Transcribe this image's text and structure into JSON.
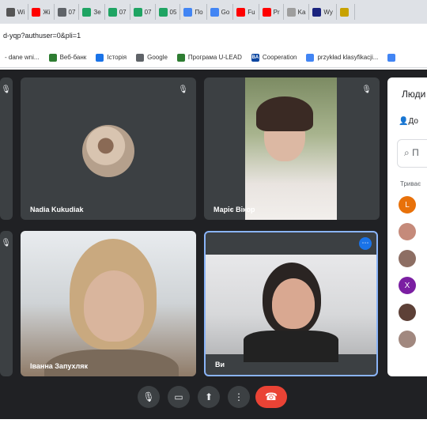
{
  "browser": {
    "tabs": [
      {
        "label": "Wi",
        "icon": "doc-icon",
        "color": "#555555"
      },
      {
        "label": "Жі",
        "icon": "youtube-icon",
        "color": "#ff0000"
      },
      {
        "label": "07",
        "icon": "globe-icon",
        "color": "#5f6368"
      },
      {
        "label": "Зе",
        "icon": "drive-icon",
        "color": "#1fa463"
      },
      {
        "label": "07",
        "icon": "drive-icon",
        "color": "#1fa463"
      },
      {
        "label": "07",
        "icon": "drive-icon",
        "color": "#1fa463"
      },
      {
        "label": "05",
        "icon": "drive-icon",
        "color": "#1fa463"
      },
      {
        "label": "По",
        "icon": "docs-icon",
        "color": "#4285f4"
      },
      {
        "label": "Go",
        "icon": "google-icon",
        "color": "#4285f4"
      },
      {
        "label": "Fu",
        "icon": "youtube-icon",
        "color": "#ff0000"
      },
      {
        "label": "Pr",
        "icon": "youtube-icon",
        "color": "#ff0000"
      },
      {
        "label": "Ka",
        "icon": "page-icon",
        "color": "#9e9e9e"
      },
      {
        "label": "Wy",
        "icon": "site-icon",
        "color": "#1a237e"
      },
      {
        "label": "",
        "icon": "crest-icon",
        "color": "#c8a200"
      }
    ],
    "url": "d-yqp?authuser=0&pli=1",
    "bookmarks": [
      {
        "label": "- dane wni...",
        "icon": "none"
      },
      {
        "label": "Веб-банк",
        "icon": "bank-icon",
        "color": "#2e7d32"
      },
      {
        "label": "Історія",
        "icon": "history-icon",
        "color": "#1a73e8"
      },
      {
        "label": "Google",
        "icon": "globe-icon",
        "color": "#5f6368"
      },
      {
        "label": "Програма U-LEAD",
        "icon": "person-icon",
        "color": "#2e7d32"
      },
      {
        "label": "Cooperation",
        "icon": "ba-icon",
        "color": "#0d47a1",
        "badge": "BA"
      },
      {
        "label": "przykład klasyfikacji...",
        "icon": "google-icon",
        "color": "#4285f4"
      },
      {
        "label": "",
        "icon": "google-icon",
        "color": "#4285f4"
      }
    ]
  },
  "meet": {
    "tiles": [
      {
        "name": "Nadia Kukudiak"
      },
      {
        "name": "Маріє Вікор"
      },
      {
        "name": "Іванна Запухляк"
      },
      {
        "name": "Ви"
      }
    ],
    "people_panel": {
      "title": "Люди",
      "add_label": "До",
      "search_placeholder": "П",
      "section_label": "Триває",
      "participants": [
        {
          "initial": "L",
          "color": "#e8710a"
        },
        {
          "initial": "",
          "color": "#c58a7a"
        },
        {
          "initial": "",
          "color": "#8d6e63"
        },
        {
          "initial": "X",
          "color": "#7b1fa2"
        },
        {
          "initial": "",
          "color": "#5d4037"
        },
        {
          "initial": "",
          "color": "#a1887f"
        }
      ]
    }
  }
}
